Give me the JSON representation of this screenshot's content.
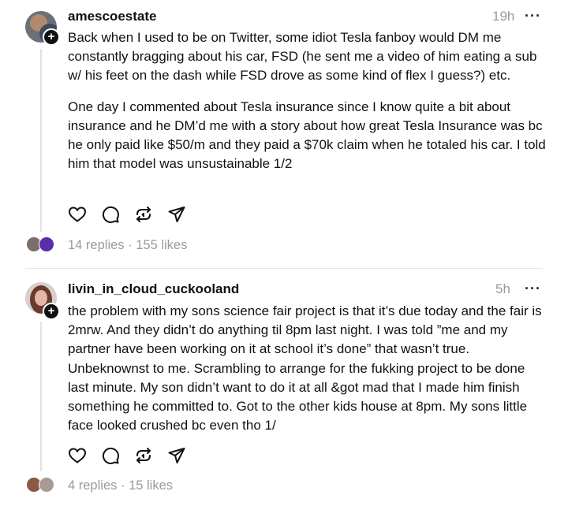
{
  "posts": [
    {
      "username": "amescoestate",
      "time": "19h",
      "more": "···",
      "paragraphs": [
        "Back when I used to be on Twitter, some idiot Tesla fanboy would DM me constantly bragging about his car, FSD (he sent me a video of him eating a sub w/ his feet on the dash while FSD drove as some kind of flex I guess?) etc.",
        "One day I commented about Tesla insurance since I know quite a bit about insurance and he DM’d me with a story about how great Tesla Insurance was bc he only paid like $50/m and they paid a $70k claim when he totaled his car. I told him that model was unsustainable 1/2"
      ],
      "replies": "14 replies",
      "separator": "·",
      "likes": "155 likes"
    },
    {
      "username": "livin_in_cloud_cuckooland",
      "time": "5h",
      "more": "···",
      "paragraphs": [
        "the problem with my sons science fair project is that it’s due today and the fair is 2mrw. And they didn’t do anything til 8pm last night. I was told ”me and my partner have been working on it at school it’s done” that wasn’t true. Unbeknownst to me. Scrambling to arrange for the fukking project to be done last minute. My son didn’t want to do it at all &got mad that I made him finish something he committed to. Got to the other kids house at 8pm. My sons little face looked crushed bc even tho 1/"
      ],
      "replies": "4 replies",
      "separator": "·",
      "likes": "15 likes"
    }
  ],
  "icons": [
    "heart-icon",
    "comment-icon",
    "repost-icon",
    "share-icon",
    "plus-icon",
    "more-icon"
  ],
  "colors": {
    "text": "#111111",
    "muted": "#9a9a9a",
    "divider": "#e6e6e6"
  }
}
